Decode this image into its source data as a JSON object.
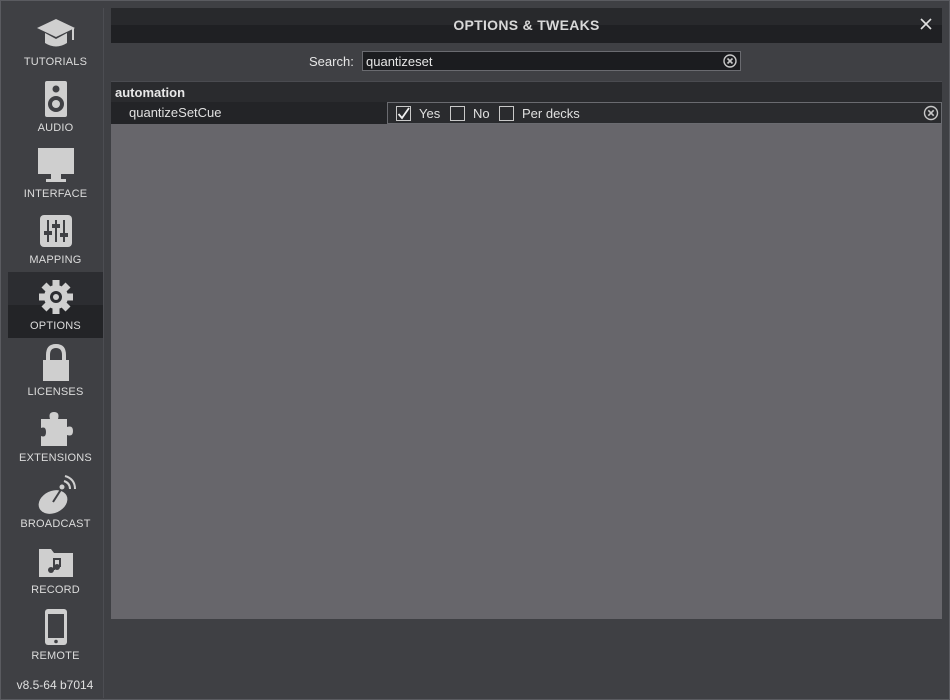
{
  "window": {
    "title": "OPTIONS & TWEAKS"
  },
  "sidebar": {
    "items": [
      {
        "label": "TUTORIALS",
        "icon": "graduation-cap-icon"
      },
      {
        "label": "AUDIO",
        "icon": "speaker-icon"
      },
      {
        "label": "INTERFACE",
        "icon": "monitor-icon"
      },
      {
        "label": "MAPPING",
        "icon": "mixer-sliders-icon"
      },
      {
        "label": "OPTIONS",
        "icon": "gear-icon",
        "active": true
      },
      {
        "label": "LICENSES",
        "icon": "lock-icon"
      },
      {
        "label": "EXTENSIONS",
        "icon": "puzzle-icon"
      },
      {
        "label": "BROADCAST",
        "icon": "satellite-dish-icon"
      },
      {
        "label": "RECORD",
        "icon": "music-folder-icon"
      },
      {
        "label": "REMOTE",
        "icon": "smartphone-icon"
      }
    ],
    "version": "v8.5-64 b7014"
  },
  "search": {
    "label": "Search:",
    "value": "quantizeset"
  },
  "options": {
    "group": "automation",
    "rows": [
      {
        "name": "quantizeSetCue",
        "choices": [
          {
            "label": "Yes",
            "checked": true
          },
          {
            "label": "No",
            "checked": false
          },
          {
            "label": "Per decks",
            "checked": false
          }
        ]
      }
    ]
  },
  "colors": {
    "background": "#3f4044",
    "panel": "#67666b",
    "header": "#1f2023",
    "text": "#e0e0e0"
  }
}
